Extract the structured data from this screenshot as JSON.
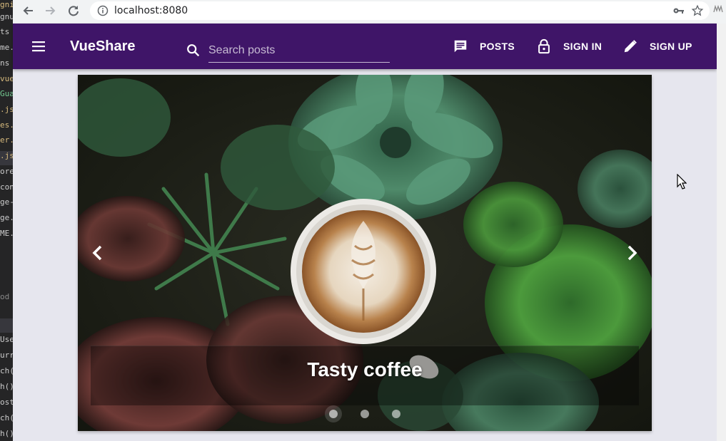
{
  "editor": {
    "lines": [
      {
        "text": "gnili",
        "color": "#d7ba7d"
      },
      {
        "text": "gnu",
        "color": "#cccccc"
      },
      {
        "text": "ts",
        "color": "#cccccc"
      },
      {
        "text": "me.",
        "color": "#cccccc"
      },
      {
        "text": "ns",
        "color": "#cccccc"
      },
      {
        "text": "vue",
        "color": "#d7ba7d"
      },
      {
        "text": "Gua",
        "color": "#73c991"
      },
      {
        "text": ".js",
        "color": "#d7ba7d"
      },
      {
        "text": "es.j",
        "color": "#d7ba7d"
      },
      {
        "text": "er.js",
        "color": "#d7ba7d"
      },
      {
        "text": ".js",
        "color": "#d7ba7d"
      },
      {
        "text": "ore",
        "color": "#cccccc"
      },
      {
        "text": "con",
        "color": "#cccccc"
      },
      {
        "text": "ge-",
        "color": "#cccccc"
      },
      {
        "text": "ge.j",
        "color": "#cccccc"
      },
      {
        "text": "ME.",
        "color": "#cccccc"
      },
      {
        "text": "od",
        "color": "#888888"
      },
      {
        "text": "Use",
        "color": "#cccccc"
      },
      {
        "text": "urre",
        "color": "#cccccc"
      },
      {
        "text": "ch()",
        "color": "#cccccc"
      },
      {
        "text": "h() <",
        "color": "#cccccc"
      },
      {
        "text": "osts",
        "color": "#cccccc"
      },
      {
        "text": "ch()",
        "color": "#cccccc"
      },
      {
        "text": "h() <",
        "color": "#cccccc"
      }
    ]
  },
  "browser": {
    "url": "localhost:8080"
  },
  "app": {
    "brand": "VueShare",
    "search_placeholder": "Search posts",
    "nav": {
      "posts": "POSTS",
      "sign_in": "SIGN IN",
      "sign_up": "SIGN UP"
    },
    "colors": {
      "toolbar": "#3f1568",
      "background": "#e6e6ee"
    }
  },
  "carousel": {
    "caption": "Tasty coffee",
    "slide_count": 3,
    "active_index": 0
  }
}
